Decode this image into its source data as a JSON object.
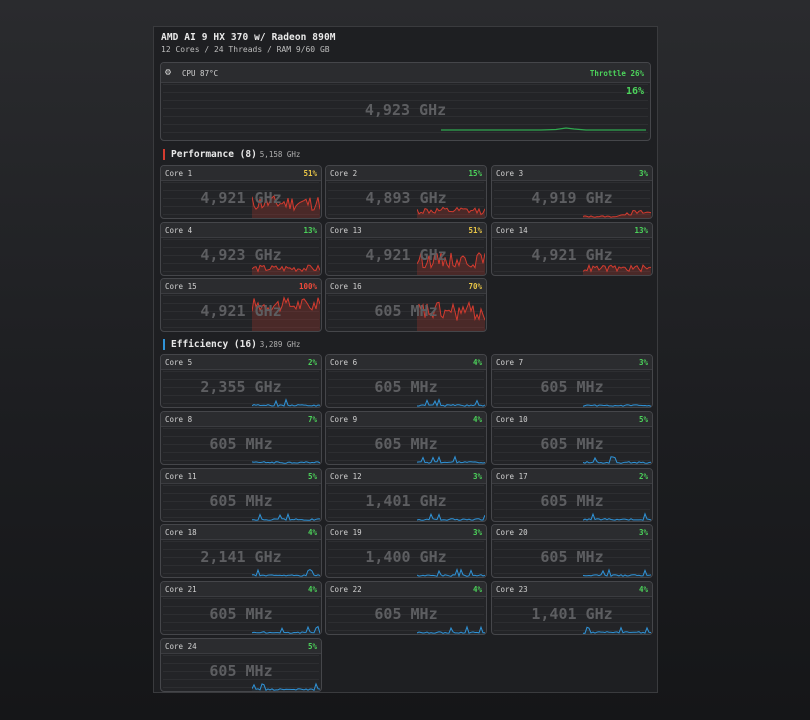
{
  "header": {
    "title": "AMD AI 9 HX 370 w/ Radeon 890M",
    "subtitle": "12 Cores / 24 Threads / RAM 9/60 GB"
  },
  "cpu": {
    "label": "CPU 87°C",
    "throttle": "Throttle 26%",
    "percent": "16%",
    "frequency": "4,923 GHz",
    "icon": "gear-icon"
  },
  "colors": {
    "performance": "#d43b2f",
    "efficiency": "#2f93d8",
    "pct_green": "#4cd35b",
    "pct_yellow": "#e8c547",
    "pct_red": "#ef4a3a",
    "cpu_line": "#2fa84f"
  },
  "performance": {
    "title": "Performance (8)",
    "subtitle": "5,158 GHz",
    "cores": [
      {
        "label": "Core 1",
        "pct": "51%",
        "freq": "4,921 GHz",
        "level": "yellow"
      },
      {
        "label": "Core 2",
        "pct": "15%",
        "freq": "4,893 GHz",
        "level": "green"
      },
      {
        "label": "Core 3",
        "pct": "3%",
        "freq": "4,919 GHz",
        "level": "green"
      },
      {
        "label": "Core 4",
        "pct": "13%",
        "freq": "4,923 GHz",
        "level": "green"
      },
      {
        "label": "Core 13",
        "pct": "51%",
        "freq": "4,921 GHz",
        "level": "yellow"
      },
      {
        "label": "Core 14",
        "pct": "13%",
        "freq": "4,921 GHz",
        "level": "green"
      },
      {
        "label": "Core 15",
        "pct": "100%",
        "freq": "4,921 GHz",
        "level": "red"
      },
      {
        "label": "Core 16",
        "pct": "70%",
        "freq": "605 MHz",
        "level": "yellow"
      }
    ]
  },
  "efficiency": {
    "title": "Efficiency (16)",
    "subtitle": "3,289 GHz",
    "cores": [
      {
        "label": "Core 5",
        "pct": "2%",
        "freq": "2,355 GHz",
        "level": "green"
      },
      {
        "label": "Core 6",
        "pct": "4%",
        "freq": "605 MHz",
        "level": "green"
      },
      {
        "label": "Core 7",
        "pct": "3%",
        "freq": "605 MHz",
        "level": "green"
      },
      {
        "label": "Core 8",
        "pct": "7%",
        "freq": "605 MHz",
        "level": "green"
      },
      {
        "label": "Core 9",
        "pct": "4%",
        "freq": "605 MHz",
        "level": "green"
      },
      {
        "label": "Core 10",
        "pct": "5%",
        "freq": "605 MHz",
        "level": "green"
      },
      {
        "label": "Core 11",
        "pct": "5%",
        "freq": "605 MHz",
        "level": "green"
      },
      {
        "label": "Core 12",
        "pct": "3%",
        "freq": "1,401 GHz",
        "level": "green"
      },
      {
        "label": "Core 17",
        "pct": "2%",
        "freq": "605 MHz",
        "level": "green"
      },
      {
        "label": "Core 18",
        "pct": "4%",
        "freq": "2,141 GHz",
        "level": "green"
      },
      {
        "label": "Core 19",
        "pct": "3%",
        "freq": "1,400 GHz",
        "level": "green"
      },
      {
        "label": "Core 20",
        "pct": "3%",
        "freq": "605 MHz",
        "level": "green"
      },
      {
        "label": "Core 21",
        "pct": "4%",
        "freq": "605 MHz",
        "level": "green"
      },
      {
        "label": "Core 22",
        "pct": "4%",
        "freq": "605 MHz",
        "level": "green"
      },
      {
        "label": "Core 23",
        "pct": "4%",
        "freq": "1,401 GHz",
        "level": "green"
      },
      {
        "label": "Core 24",
        "pct": "5%",
        "freq": "605 MHz",
        "level": "green"
      }
    ]
  }
}
